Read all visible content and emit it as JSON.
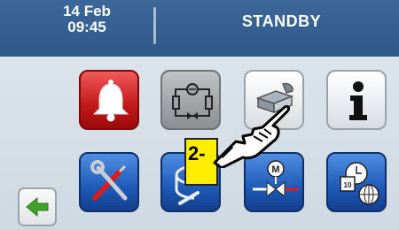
{
  "header": {
    "date": "14 Feb",
    "time": "09:45",
    "status": "STANDBY"
  },
  "tiles": [
    {
      "name": "alarm",
      "icon": "bell-icon",
      "color": "#c21818"
    },
    {
      "name": "circuit",
      "icon": "refrigeration-circuit-icon",
      "color": "#9fa3a6"
    },
    {
      "name": "manuals",
      "icon": "manuals-icon",
      "color": "#ffffff"
    },
    {
      "name": "info",
      "icon": "info-icon",
      "color": "#ffffff"
    },
    {
      "name": "service",
      "icon": "tools-icon",
      "color": "#1e5ab8"
    },
    {
      "name": "sensors",
      "icon": "sensor-probe-icon",
      "color": "#1e5ab8"
    },
    {
      "name": "valve",
      "icon": "motorized-valve-icon",
      "color": "#1e5ab8"
    },
    {
      "name": "clock-settings",
      "icon": "calendar-clock-globe-icon",
      "color": "#1e5ab8"
    }
  ],
  "back": {
    "icon": "left-arrow-icon",
    "color": "#3fa32a"
  },
  "overlay": {
    "step_label": "2-",
    "pointer_icon": "pointing-hand-icon"
  }
}
